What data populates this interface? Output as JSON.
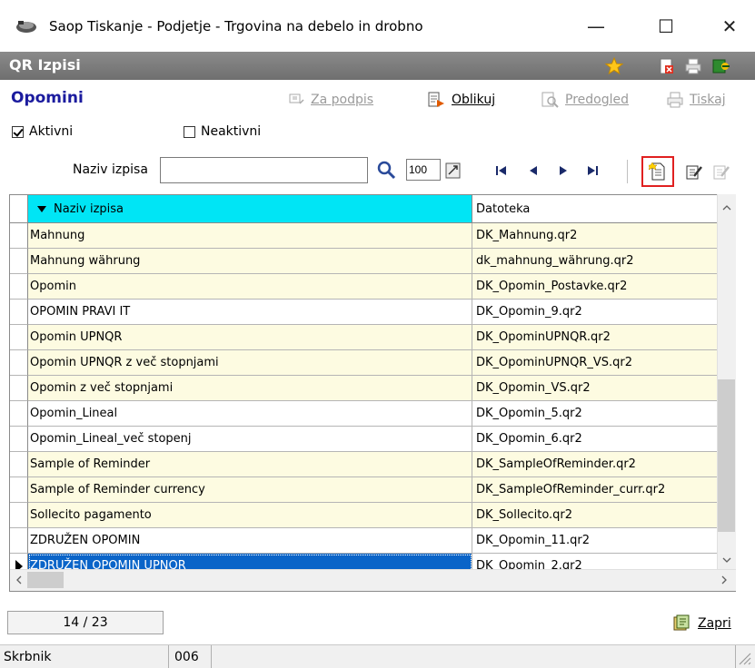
{
  "window": {
    "title": "Saop Tiskanje - Podjetje - Trgovina na debelo in drobno",
    "minimize": "—",
    "maximize": "☐",
    "close": "✕"
  },
  "module": {
    "title": "QR Izpisi"
  },
  "form": {
    "title": "Opomini"
  },
  "toolbar": {
    "za_podpis": "Za podpis",
    "oblikuj": "Oblikuj",
    "predogled": "Predogled",
    "tiskaj": "Tiskaj"
  },
  "filters": {
    "active_label": "Aktivni",
    "active_checked": true,
    "inactive_label": "Neaktivni",
    "inactive_checked": false
  },
  "search": {
    "label": "Naziv izpisa",
    "value": "",
    "zoom_value": "100"
  },
  "grid": {
    "columns": [
      "Naziv izpisa",
      "Datoteka"
    ],
    "rows": [
      [
        "Mahnung",
        "DK_Mahnung.qr2"
      ],
      [
        "Mahnung währung",
        "dk_mahnung_währung.qr2"
      ],
      [
        "Opomin",
        "DK_Opomin_Postavke.qr2"
      ],
      [
        "OPOMIN PRAVI IT",
        "DK_Opomin_9.qr2"
      ],
      [
        "Opomin UPNQR",
        "DK_OpominUPNQR.qr2"
      ],
      [
        "Opomin UPNQR z več stopnjami",
        "DK_OpominUPNQR_VS.qr2"
      ],
      [
        "Opomin z več stopnjami",
        "DK_Opomin_VS.qr2"
      ],
      [
        "Opomin_Lineal",
        "DK_Opomin_5.qr2"
      ],
      [
        "Opomin_Lineal_več stopenj",
        "DK_Opomin_6.qr2"
      ],
      [
        "Sample of Reminder",
        "DK_SampleOfReminder.qr2"
      ],
      [
        "Sample of Reminder currency",
        "DK_SampleOfReminder_curr.qr2"
      ],
      [
        "Sollecito pagamento",
        "DK_Sollecito.qr2"
      ],
      [
        "ZDRUŽEN OPOMIN",
        "DK_Opomin_11.qr2"
      ],
      [
        "ZDRUŽEN OPOMIN UPNQR",
        "DK_Opomin_2.qr2"
      ]
    ],
    "selected_row": 13
  },
  "footer": {
    "record_counter": "14 / 23",
    "close_label": "Zapri"
  },
  "status": {
    "user": "Skrbnik",
    "code": "006"
  },
  "colors": {
    "header_accent": "#00e5f5",
    "row_tint": "#fdfbe1",
    "selection": "#0a64c8",
    "highlight_border": "#e02020",
    "form_title": "#1b1b9e"
  }
}
